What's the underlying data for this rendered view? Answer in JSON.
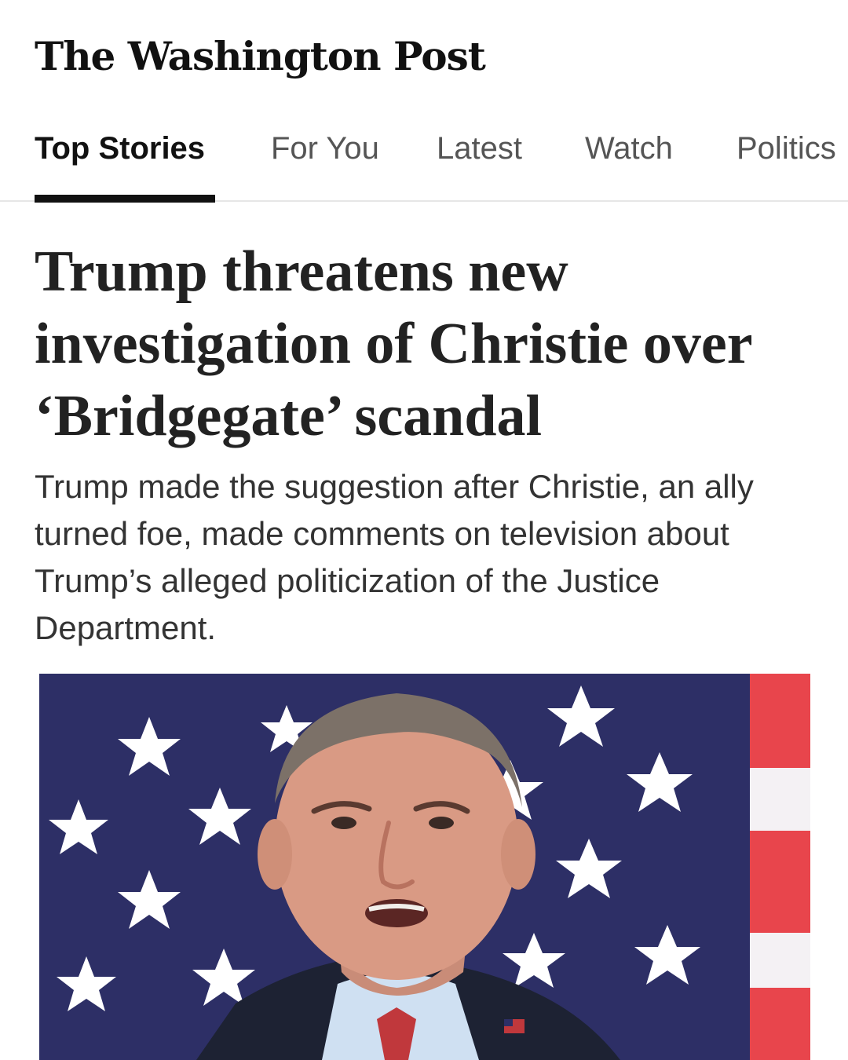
{
  "masthead": {
    "title": "The Washington Post"
  },
  "tabs": [
    {
      "label": "Top Stories",
      "active": true
    },
    {
      "label": "For You",
      "active": false
    },
    {
      "label": "Latest",
      "active": false
    },
    {
      "label": "Watch",
      "active": false
    },
    {
      "label": "Politics",
      "active": false
    }
  ],
  "article": {
    "headline": "Trump threatens new investigation of Christie over ‘Bridgegate’ scandal",
    "dek": "Trump made the suggestion after Christie, an ally turned foe, made comments on television about Trump’s alleged politicization of the Justice Department."
  },
  "photo": {
    "background_color": "#2d2f66",
    "stripe_red": "#e8454c",
    "stripe_white": "#f4f1f4",
    "subject_icon": "person-photo"
  }
}
